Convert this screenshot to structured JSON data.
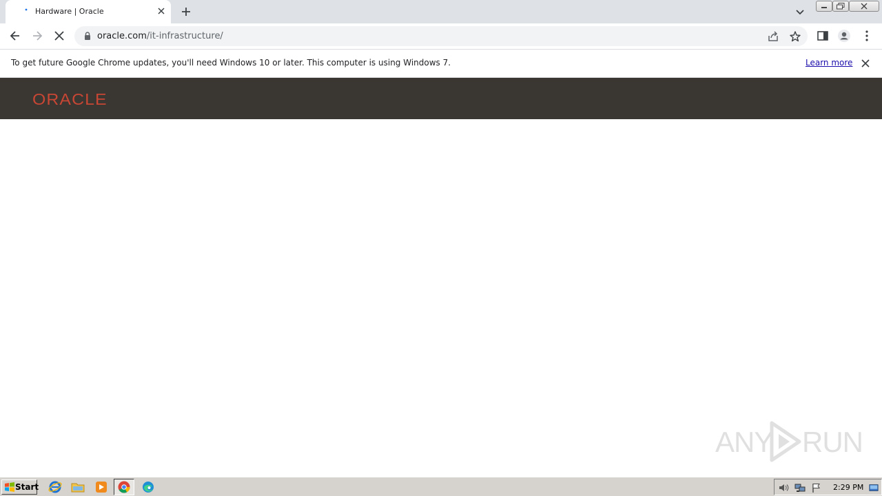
{
  "browser": {
    "tab": {
      "title": "Hardware | Oracle"
    },
    "omnibox": {
      "domain": "oracle.com",
      "path": "/it-infrastructure/"
    }
  },
  "infobar": {
    "message": "To get future Google Chrome updates, you'll need Windows 10 or later. This computer is using Windows 7.",
    "link": "Learn more"
  },
  "page": {
    "logo_text": "ORACLE",
    "header_bg": "#3a3632",
    "logo_color": "#c74634"
  },
  "watermark": {
    "left": "ANY",
    "right": "RUN"
  },
  "taskbar": {
    "start_label": "Start",
    "apps": [
      "internet-explorer-icon",
      "folder-icon",
      "media-player-icon",
      "chrome-icon",
      "edge-icon"
    ],
    "clock": "2:29 PM"
  }
}
